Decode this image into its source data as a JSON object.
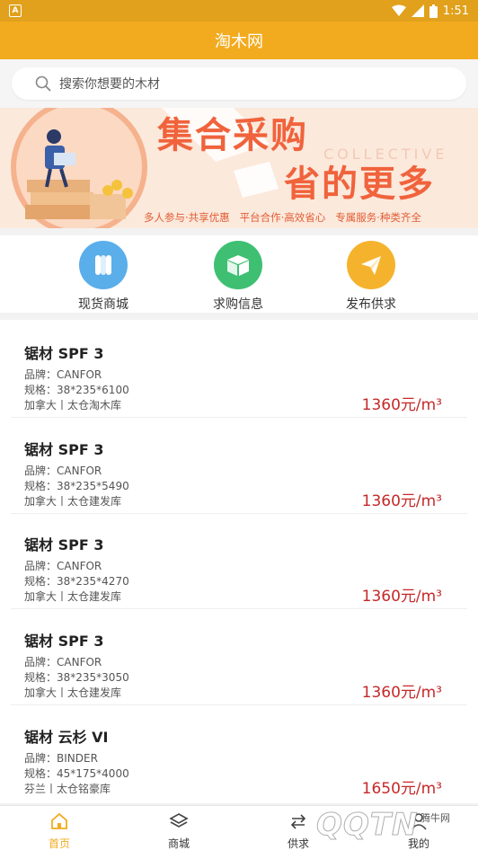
{
  "status_bar": {
    "time": "1:51"
  },
  "header": {
    "title": "淘木网"
  },
  "search": {
    "placeholder": "搜索你想要的木材"
  },
  "banner": {
    "headline1": "集合采购",
    "headline2": "省的更多",
    "english": "COLLECTIVE",
    "tags": "多人参与·共享优惠   平台合作·高效省心   专属服务·种类齐全"
  },
  "quick_actions": [
    {
      "label": "现货商城",
      "color": "#5aaeea",
      "icon": "lumber-icon"
    },
    {
      "label": "求购信息",
      "color": "#3fbf72",
      "icon": "box-icon"
    },
    {
      "label": "发布供求",
      "color": "#f5b32d",
      "icon": "paper-plane-icon"
    }
  ],
  "products": [
    {
      "name": "锯材 SPF 3",
      "brand": "品牌：CANFOR",
      "spec": "规格：38*235*6100",
      "origin": "加拿大丨太仓淘木库",
      "price": "1360元/m³"
    },
    {
      "name": "锯材 SPF 3",
      "brand": "品牌：CANFOR",
      "spec": "规格：38*235*5490",
      "origin": "加拿大丨太仓建发库",
      "price": "1360元/m³"
    },
    {
      "name": "锯材 SPF 3",
      "brand": "品牌：CANFOR",
      "spec": "规格：38*235*4270",
      "origin": "加拿大丨太仓建发库",
      "price": "1360元/m³"
    },
    {
      "name": "锯材 SPF 3",
      "brand": "品牌：CANFOR",
      "spec": "规格：38*235*3050",
      "origin": "加拿大丨太仓建发库",
      "price": "1360元/m³"
    },
    {
      "name": "锯材 云杉 VI",
      "brand": "品牌：BINDER",
      "spec": "规格：45*175*4000",
      "origin": "芬兰丨太仓铭豪库",
      "price": "1650元/m³"
    }
  ],
  "tabbar": [
    {
      "label": "首页",
      "icon": "home-icon",
      "active": true
    },
    {
      "label": "商城",
      "icon": "layers-icon",
      "active": false
    },
    {
      "label": "供求",
      "icon": "exchange-icon",
      "active": false
    },
    {
      "label": "我的",
      "icon": "user-icon",
      "active": false
    }
  ],
  "watermark": {
    "text": "腾牛网",
    "logo": "QQTN"
  },
  "colors": {
    "brand": "#f2ab1f",
    "price": "#c62828"
  }
}
